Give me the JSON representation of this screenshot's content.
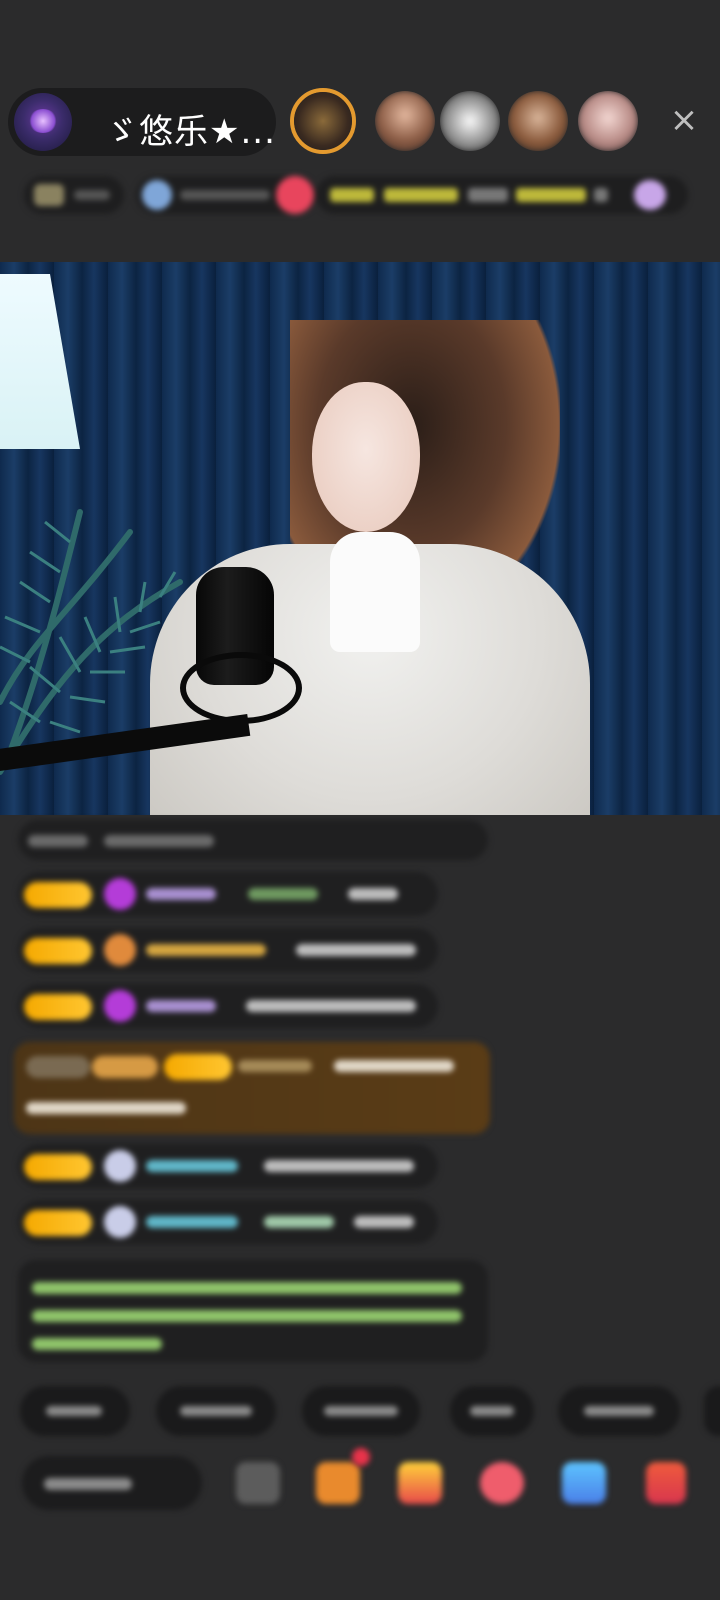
{
  "header": {
    "host_name": "ゞ悠乐★...",
    "close_label": "×"
  },
  "colors": {
    "background": "#2b2b2c",
    "pill": "#1c1c1d",
    "badge_gold": "#f5a900",
    "highlight_green": "#9cdd7a",
    "gift_message_bg": "#5a3c16"
  },
  "icons": {
    "close": "close-icon",
    "emoji": "emoji-icon",
    "gift": "gift-icon",
    "gift_box": "gift-box-icon",
    "heart": "heart-icon",
    "message": "message-icon",
    "shop": "shop-icon"
  }
}
